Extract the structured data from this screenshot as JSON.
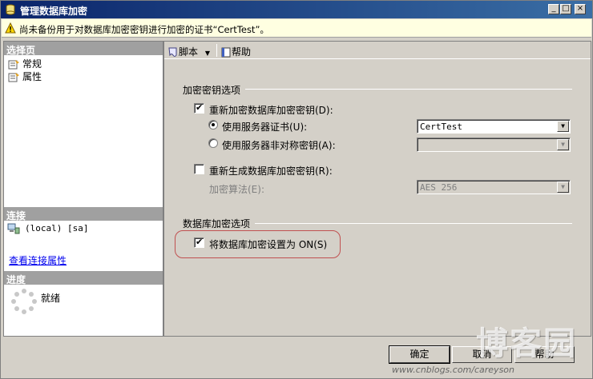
{
  "window": {
    "title": "管理数据库加密",
    "warning": "尚未备份用于对数据库加密密钥进行加密的证书“CertTest”。"
  },
  "left": {
    "select_page_header": "选择页",
    "pages": [
      {
        "label": "常规",
        "icon": "page-icon"
      },
      {
        "label": "属性",
        "icon": "page-icon"
      }
    ],
    "connection_header": "连接",
    "connection_text": "(local) [sa]",
    "view_connection_link": "查看连接属性",
    "progress_header": "进度",
    "progress_status": "就绪"
  },
  "toolbar": {
    "script_label": "脚本",
    "help_label": "帮助"
  },
  "encryption_key_options": {
    "group_label": "加密密钥选项",
    "regenerate_label": "重新加密数据库加密密钥(D):",
    "regenerate_checked": true,
    "use_cert_label": "使用服务器证书(U):",
    "use_cert_selected": true,
    "cert_value": "CertTest",
    "use_asym_label": "使用服务器非对称密钥(A):",
    "asym_value": "",
    "regen_db_key_label": "重新生成数据库加密密钥(R):",
    "regen_db_key_checked": false,
    "algorithm_label": "加密算法(E):",
    "algorithm_value": "AES 256"
  },
  "db_encryption_options": {
    "group_label": "数据库加密选项",
    "set_on_label": "将数据库加密设置为 ON(S)",
    "set_on_checked": true
  },
  "buttons": {
    "ok": "确定",
    "cancel": "取消",
    "help": "帮助"
  },
  "watermark": {
    "text": "博客园",
    "url": "www.cnblogs.com/careyson"
  },
  "colors": {
    "titlebar": "#0a246a",
    "warning_bg": "#ffffe1",
    "highlight_border": "#c05050"
  }
}
